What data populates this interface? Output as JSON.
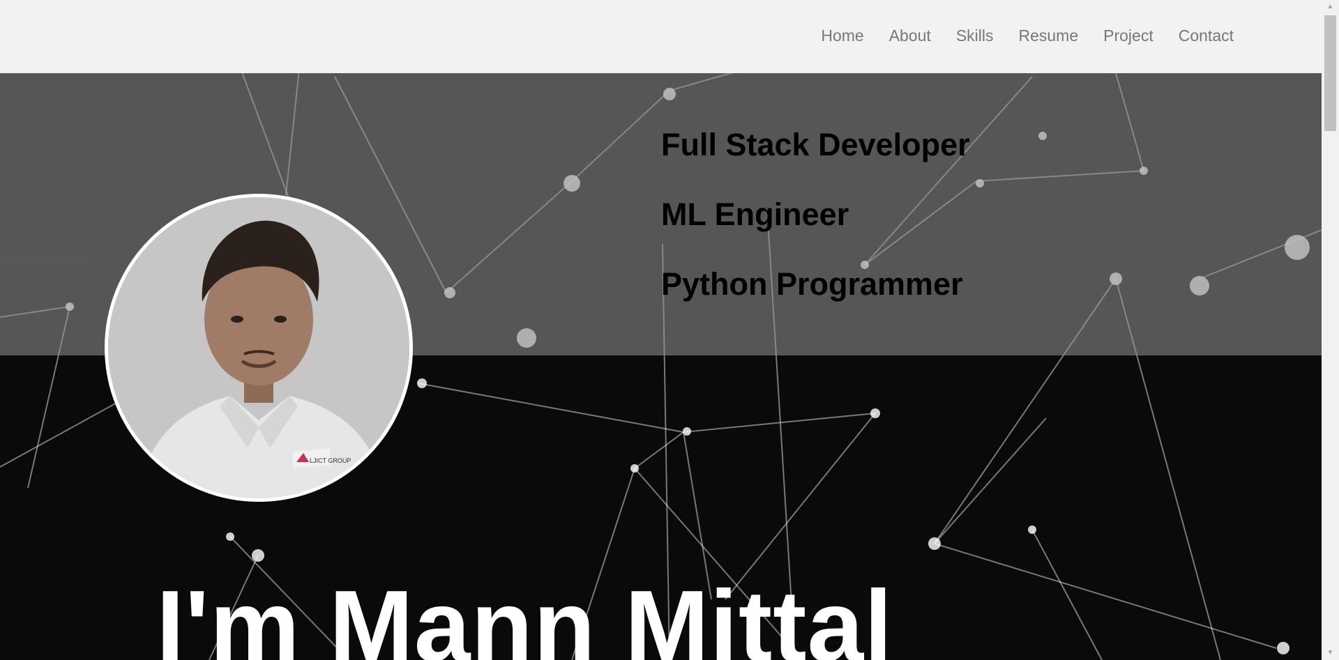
{
  "nav": {
    "items": [
      {
        "label": "Home"
      },
      {
        "label": "About"
      },
      {
        "label": "Skills"
      },
      {
        "label": "Resume"
      },
      {
        "label": "Project"
      },
      {
        "label": "Contact"
      }
    ]
  },
  "hero": {
    "roles": [
      "Full Stack Developer",
      "ML Engineer",
      "Python Programmer"
    ],
    "headline": "I'm Mann Mittal",
    "avatar_icon": "profile-photo",
    "shirt_logo_text": "LJICT GROUP"
  },
  "colors": {
    "nav_bg": "#f2f2f2",
    "nav_text": "#777777",
    "band_overlay": "#8a8a8a",
    "background": "#0a0a0a",
    "headline": "#ffffff",
    "roles": "#000000"
  }
}
